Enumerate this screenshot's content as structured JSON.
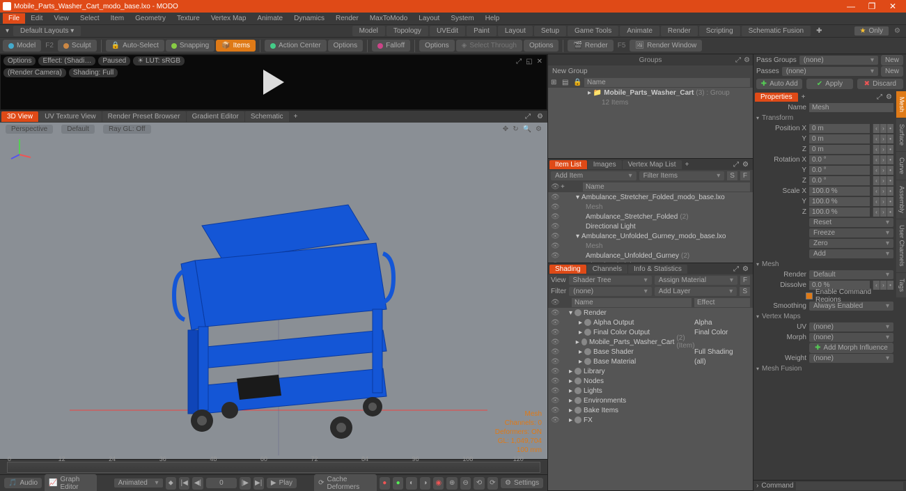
{
  "title": "Mobile_Parts_Washer_Cart_modo_base.lxo - MODO",
  "menubar": [
    "File",
    "Edit",
    "View",
    "Select",
    "Item",
    "Geometry",
    "Texture",
    "Vertex Map",
    "Animate",
    "Dynamics",
    "Render",
    "MaxToModo",
    "Layout",
    "System",
    "Help"
  ],
  "layoutDrop": "Default Layouts",
  "modeTabs": [
    "Model",
    "Topology",
    "UVEdit",
    "Paint",
    "Layout",
    "Setup",
    "Game Tools",
    "Animate",
    "Render",
    "Scripting",
    "Schematic Fusion"
  ],
  "only": "Only",
  "toolbar": {
    "model": "Model",
    "sculpt": "Sculpt",
    "autoSelect": "Auto-Select",
    "snapping": "Snapping",
    "items": "Items",
    "actionCenter": "Action Center",
    "options1": "Options",
    "falloff": "Falloff",
    "options2": "Options",
    "selectThrough": "Select Through",
    "options3": "Options",
    "render": "Render",
    "renderWindow": "Render Window",
    "f5": "F5",
    "f2": "F2"
  },
  "preview": {
    "options": "Options",
    "effect": "Effect: (Shadi…",
    "paused": "Paused",
    "lut": "LUT: sRGB",
    "renderCamera": "(Render Camera)",
    "shadingFull": "Shading: Full"
  },
  "vpTabs": [
    "3D View",
    "UV Texture View",
    "Render Preset Browser",
    "Gradient Editor",
    "Schematic"
  ],
  "vpBar": {
    "persp": "Perspective",
    "default": "Default",
    "raygl": "Ray GL: Off"
  },
  "stats": {
    "type": "Mesh",
    "channels": "Channels: 0",
    "deformers": "Deformers: ON",
    "gl": "GL: 1,049,704",
    "scale": "100 mm"
  },
  "timelineTicks": [
    "0",
    "12",
    "24",
    "36",
    "48",
    "60",
    "72",
    "84",
    "96",
    "108",
    "120"
  ],
  "playbar": {
    "audio": "Audio",
    "graphEditor": "Graph Editor",
    "animated": "Animated",
    "frame": "0",
    "play": "Play",
    "cacheDeformers": "Cache Deformers",
    "settings": "Settings"
  },
  "groups": {
    "title": "Groups",
    "newGroup": "New Group",
    "nameHdr": "Name",
    "item": "Mobile_Parts_Washer_Cart",
    "itemSuffix": "(3) : Group",
    "itemCount": "12 Items"
  },
  "passGroups": {
    "lbl": "Pass Groups",
    "val": "(none)",
    "new": "New"
  },
  "passes": {
    "lbl": "Passes",
    "val": "(none)",
    "new": "New"
  },
  "actions": {
    "autoAdd": "Auto Add",
    "apply": "Apply",
    "discard": "Discard"
  },
  "itemListTabs": [
    "Item List",
    "Images",
    "Vertex Map List"
  ],
  "itemList": {
    "addItem": "Add Item",
    "filterItems": "Filter Items",
    "nameHdr": "Name",
    "rows": [
      {
        "t": "Ambulance_Stretcher_Folded_modo_base.lxo",
        "d": 0,
        "exp": true
      },
      {
        "t": "Mesh",
        "d": 1,
        "dim": true
      },
      {
        "t": "Ambulance_Stretcher_Folded",
        "d": 1,
        "suf": "(2)"
      },
      {
        "t": "Directional Light",
        "d": 1
      },
      {
        "t": "Ambulance_Unfolded_Gurney_modo_base.lxo",
        "d": 0,
        "exp": true
      },
      {
        "t": "Mesh",
        "d": 1,
        "dim": true
      },
      {
        "t": "Ambulance_Unfolded_Gurney",
        "d": 1,
        "suf": "(2)"
      },
      {
        "t": "Directional Light",
        "d": 1
      }
    ]
  },
  "shadingTabs": [
    "Shading",
    "Channels",
    "Info & Statistics"
  ],
  "shading": {
    "view": "View",
    "shaderTree": "Shader Tree",
    "assignMaterial": "Assign Material",
    "filter": "Filter",
    "none": "(none)",
    "addLayer": "Add Layer",
    "nameHdr": "Name",
    "effectHdr": "Effect",
    "rows": [
      {
        "t": "Render",
        "d": 0,
        "exp": true,
        "eff": ""
      },
      {
        "t": "Alpha Output",
        "d": 1,
        "eff": "Alpha"
      },
      {
        "t": "Final Color Output",
        "d": 1,
        "eff": "Final Color"
      },
      {
        "t": "Mobile_Parts_Washer_Cart",
        "d": 1,
        "suf": "(2) (Item)",
        "eff": ""
      },
      {
        "t": "Base Shader",
        "d": 1,
        "eff": "Full Shading"
      },
      {
        "t": "Base Material",
        "d": 1,
        "eff": "(all)"
      },
      {
        "t": "Library",
        "d": 0,
        "eff": ""
      },
      {
        "t": "Nodes",
        "d": 0,
        "eff": ""
      },
      {
        "t": "Lights",
        "d": 0,
        "eff": ""
      },
      {
        "t": "Environments",
        "d": 0,
        "eff": ""
      },
      {
        "t": "Bake Items",
        "d": 0,
        "eff": ""
      },
      {
        "t": "FX",
        "d": 0,
        "eff": ""
      }
    ]
  },
  "props": {
    "propertiesTab": "Properties",
    "nameLbl": "Name",
    "nameVal": "Mesh",
    "transform": "Transform",
    "posX": "Position X",
    "y": "Y",
    "z": "Z",
    "val0": "0 m",
    "rotX": "Rotation X",
    "deg0": "0.0 °",
    "scaleX": "Scale X",
    "pct100": "100.0 %",
    "reset": "Reset",
    "freeze": "Freeze",
    "zero": "Zero",
    "add": "Add",
    "meshSection": "Mesh",
    "renderLbl": "Render",
    "renderVal": "Default",
    "dissolveLbl": "Dissolve",
    "dissolveVal": "0.0 %",
    "enableCmd": "Enable Command Regions",
    "smoothingLbl": "Smoothing",
    "smoothingVal": "Always Enabled",
    "vmaps": "Vertex Maps",
    "uvLbl": "UV",
    "noneVal": "(none)",
    "morphLbl": "Morph",
    "addMorph": "Add Morph Influence",
    "weightLbl": "Weight",
    "meshFusion": "Mesh Fusion"
  },
  "sideTabs": [
    "Mesh",
    "Surface",
    "Curve",
    "Assembly",
    "User Channels",
    "Tags"
  ],
  "cmdLbl": "Command"
}
